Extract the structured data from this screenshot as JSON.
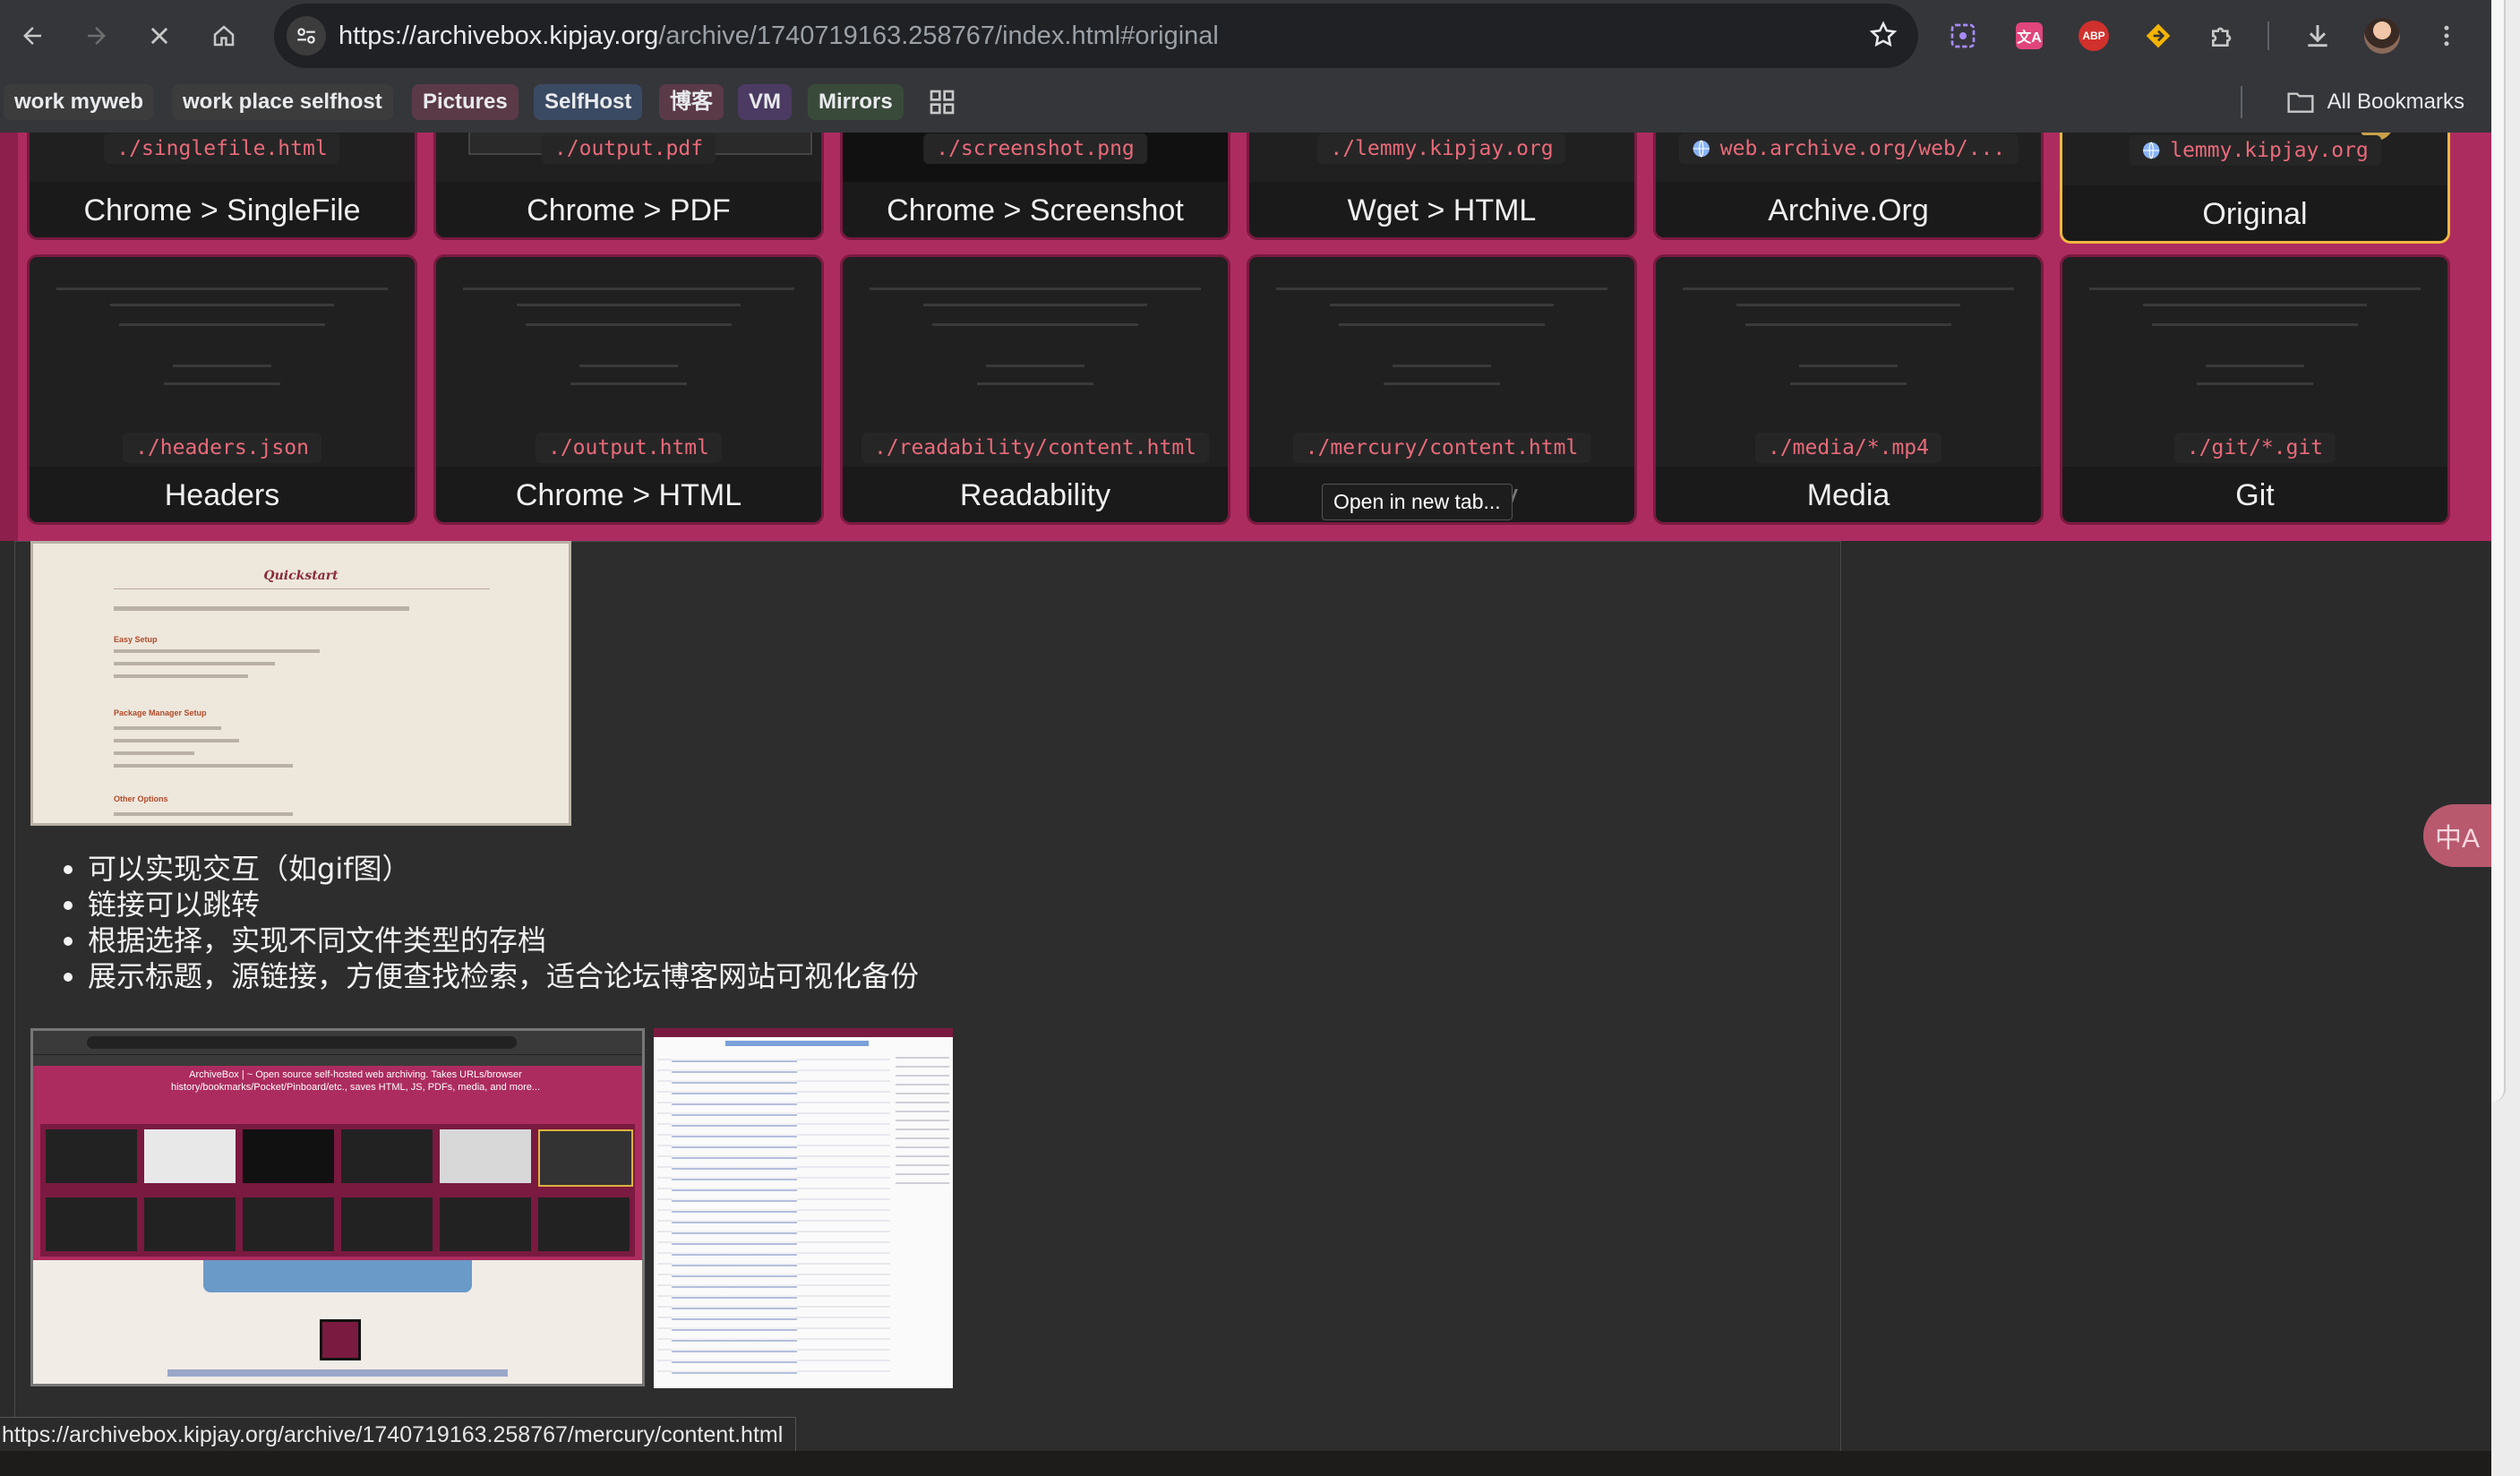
{
  "browser": {
    "url": {
      "host": "https://archivebox.kipjay.org",
      "path": "/archive/1740719163.258767/index.html#original"
    },
    "icons": [
      "back-arrow-icon",
      "forward-arrow-icon",
      "close-icon",
      "home-icon",
      "site-settings-icon",
      "star-icon",
      "extension-screenshot-icon",
      "translate-extension-icon",
      "adblock-icon",
      "extension-diamond-icon",
      "puzzle-icon",
      "download-icon",
      "profile-avatar",
      "more-menu-icon"
    ],
    "adblock_label": "ABP"
  },
  "bookmarks": {
    "items": [
      {
        "label": "work myweb",
        "color": "#3c3c3c"
      },
      {
        "label": "work place selfhost",
        "color": "#3c3c3c"
      },
      {
        "label": "Pictures",
        "color": "#5b3a47"
      },
      {
        "label": "SelfHost",
        "color": "#3b4a63"
      },
      {
        "label": "博客",
        "color": "#5b3a47"
      },
      {
        "label": "VM",
        "color": "#4b3b63"
      },
      {
        "label": "Mirrors",
        "color": "#3a4a3a"
      }
    ],
    "all_bookmarks": "All Bookmarks"
  },
  "archive": {
    "row1": [
      {
        "path": "./singlefile.html",
        "label": "Chrome > SingleFile"
      },
      {
        "path": "./output.pdf",
        "label": "Chrome > PDF"
      },
      {
        "path": "./screenshot.png",
        "label": "Chrome > Screenshot"
      },
      {
        "path": "./lemmy.kipjay.org",
        "label": "Wget > HTML"
      },
      {
        "path": "web.archive.org/web/...",
        "label": "Archive.Org"
      },
      {
        "path": "lemmy.kipjay.org",
        "label": "Original"
      }
    ],
    "row2": [
      {
        "path": "./headers.json",
        "label": "Headers"
      },
      {
        "path": "./output.html",
        "label": "Chrome > HTML"
      },
      {
        "path": "./readability/content.html",
        "label": "Readability"
      },
      {
        "path": "./mercury/content.html",
        "label": "Mercury"
      },
      {
        "path": "./media/*.mp4",
        "label": "Media"
      },
      {
        "path": "./git/*.git",
        "label": "Git"
      }
    ],
    "tooltip": "Open in new tab..."
  },
  "content": {
    "quickstart": {
      "title": "Quickstart",
      "easy_setup": "Easy Setup",
      "package_manager_setup": "Package Manager Setup",
      "other_options": "Other Options"
    },
    "bullets": [
      "可以实现交互（如gif图）",
      "链接可以跳转",
      "根据选择，实现不同文件类型的存档",
      "展示标题，源链接，方便查找检索，适合论坛博客网站可视化备份"
    ],
    "screenshot_left": {
      "title": "ArchiveBox | ~ Open source self-hosted web archiving. Takes URLs/browser history/bookmarks/Pocket/Pinboard/etc., saves HTML, JS, PDFs, media, and more..."
    }
  },
  "translate_fab": "中A",
  "status_bar": "https://archivebox.kipjay.org/archive/1740719163.258767/mercury/content.html"
}
